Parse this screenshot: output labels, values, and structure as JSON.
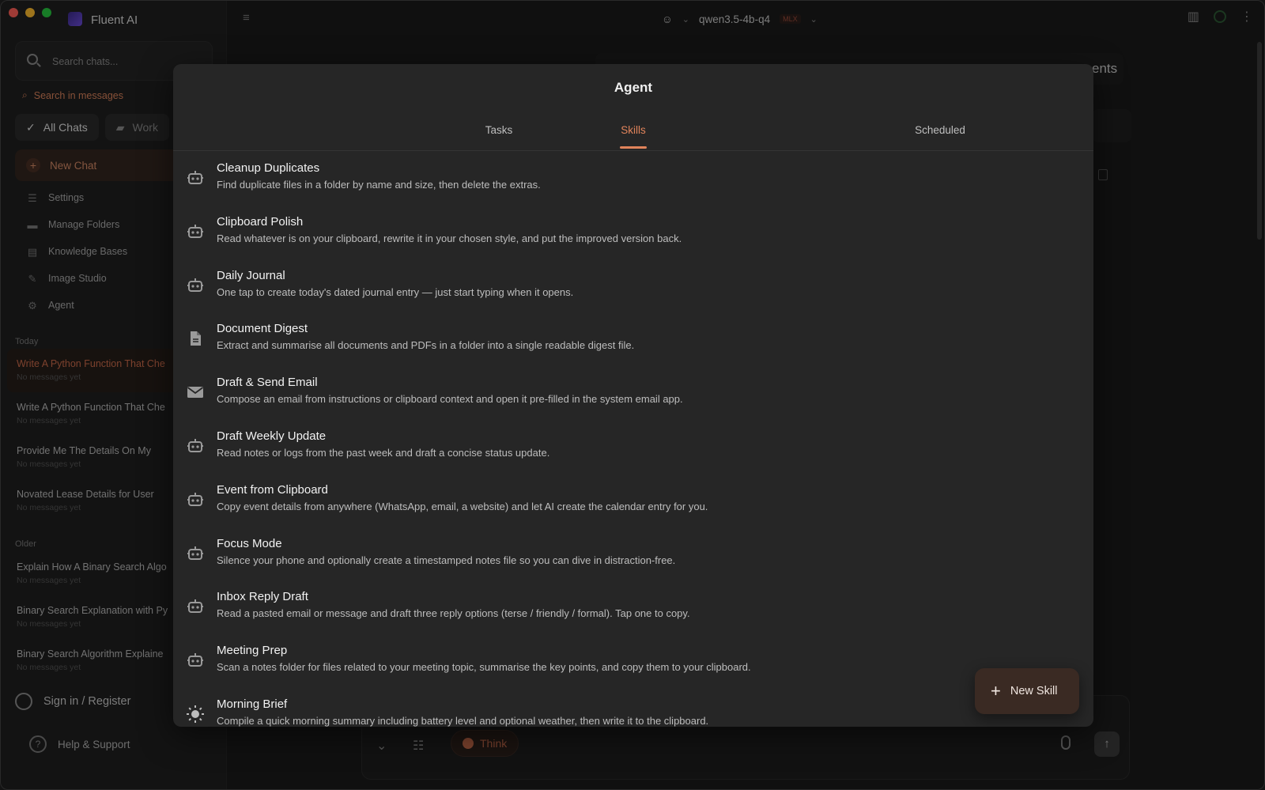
{
  "app": {
    "title": "Fluent AI"
  },
  "sidebar": {
    "search_placeholder": "Search chats...",
    "search_messages": "Search in messages",
    "filters": [
      {
        "label": "All Chats"
      },
      {
        "label": "Work"
      }
    ],
    "new_chat": "New Chat",
    "nav": [
      {
        "label": "Settings",
        "icon": "settings-icon"
      },
      {
        "label": "Manage Folders",
        "icon": "folder-icon"
      },
      {
        "label": "Knowledge Bases",
        "icon": "book-icon"
      },
      {
        "label": "Image Studio",
        "icon": "brush-icon"
      },
      {
        "label": "Agent",
        "icon": "robot-icon"
      }
    ],
    "today_label": "Today",
    "older_label": "Older",
    "today_chats": [
      {
        "title": "Write A Python Function That Che",
        "sub": "No messages yet"
      },
      {
        "title": "Write A Python Function That Che",
        "sub": "No messages yet"
      },
      {
        "title": "Provide Me The Details On My",
        "sub": "No messages yet"
      },
      {
        "title": "Novated Lease Details for User",
        "sub": "No messages yet"
      }
    ],
    "older_chats": [
      {
        "title": "Explain How A Binary Search Algo",
        "sub": "No messages yet"
      },
      {
        "title": "Binary Search Explanation with Py",
        "sub": "No messages yet"
      },
      {
        "title": "Binary Search Algorithm Explaine",
        "sub": "No messages yet"
      }
    ],
    "sign_in": "Sign in / Register",
    "help": "Help & Support"
  },
  "topbar": {
    "model": "qwen3.5-4b-q4",
    "model_badge": "MLX"
  },
  "background": {
    "partial_text": "ents"
  },
  "composer": {
    "think_label": "Think"
  },
  "modal": {
    "title": "Agent",
    "tabs": [
      {
        "label": "Tasks"
      },
      {
        "label": "Skills"
      },
      {
        "label": "Scheduled"
      }
    ],
    "active_tab": "Skills",
    "skills": [
      {
        "name": "Cleanup Duplicates",
        "desc": "Find duplicate files in a folder by name and size, then delete the extras.",
        "icon": "robot-icon"
      },
      {
        "name": "Clipboard Polish",
        "desc": "Read whatever is on your clipboard, rewrite it in your chosen style, and put the improved version back.",
        "icon": "robot-icon"
      },
      {
        "name": "Daily Journal",
        "desc": "One tap to create today's dated journal entry — just start typing when it opens.",
        "icon": "robot-icon"
      },
      {
        "name": "Document Digest",
        "desc": "Extract and summarise all documents and PDFs in a folder into a single readable digest file.",
        "icon": "document-icon"
      },
      {
        "name": "Draft & Send Email",
        "desc": "Compose an email from instructions or clipboard context and open it pre-filled in the system email app.",
        "icon": "envelope-icon"
      },
      {
        "name": "Draft Weekly Update",
        "desc": "Read notes or logs from the past week and draft a concise status update.",
        "icon": "robot-icon"
      },
      {
        "name": "Event from Clipboard",
        "desc": "Copy event details from anywhere (WhatsApp, email, a website) and let AI create the calendar entry for you.",
        "icon": "robot-icon"
      },
      {
        "name": "Focus Mode",
        "desc": "Silence your phone and optionally create a timestamped notes file so you can dive in distraction-free.",
        "icon": "robot-icon"
      },
      {
        "name": "Inbox Reply Draft",
        "desc": "Read a pasted email or message and draft three reply options (terse / friendly / formal). Tap one to copy.",
        "icon": "robot-icon"
      },
      {
        "name": "Meeting Prep",
        "desc": "Scan a notes folder for files related to your meeting topic, summarise the key points, and copy them to your clipboard.",
        "icon": "robot-icon"
      },
      {
        "name": "Morning Brief",
        "desc": "Compile a quick morning summary including battery level and optional weather, then write it to the clipboard.",
        "icon": "sun-icon"
      }
    ],
    "new_skill": "New Skill"
  },
  "colors": {
    "accent": "#e0835b",
    "background": "#1a1a1a",
    "modal": "#262626"
  }
}
